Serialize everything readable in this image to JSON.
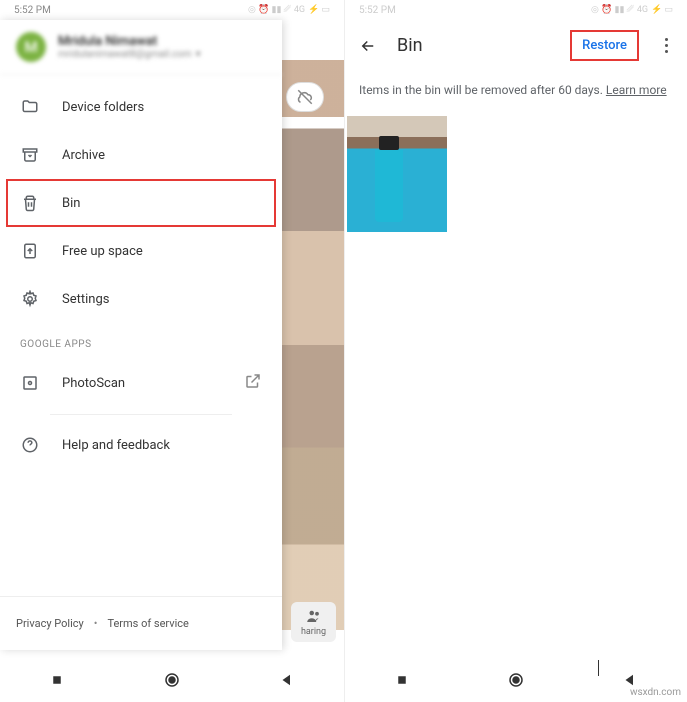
{
  "statusbar": {
    "time": "5:52 PM",
    "network": "4G"
  },
  "account": {
    "initial": "M",
    "name": "Mridula Nimawat",
    "email": "mridulanimawat8@gmail.com"
  },
  "menu": {
    "items": [
      {
        "label": "Device folders"
      },
      {
        "label": "Archive"
      },
      {
        "label": "Bin"
      },
      {
        "label": "Free up space"
      },
      {
        "label": "Settings"
      }
    ],
    "sectionHeader": "GOOGLE APPS",
    "apps": [
      {
        "label": "PhotoScan"
      }
    ],
    "help": "Help and feedback"
  },
  "footer": {
    "privacy": "Privacy Policy",
    "terms": "Terms of service"
  },
  "sharing": "haring",
  "bin": {
    "title": "Bin",
    "restore": "Restore",
    "info": "Items in the bin will be removed after 60 days. ",
    "learnMore": "Learn more"
  },
  "watermark": "wsxdn.com"
}
